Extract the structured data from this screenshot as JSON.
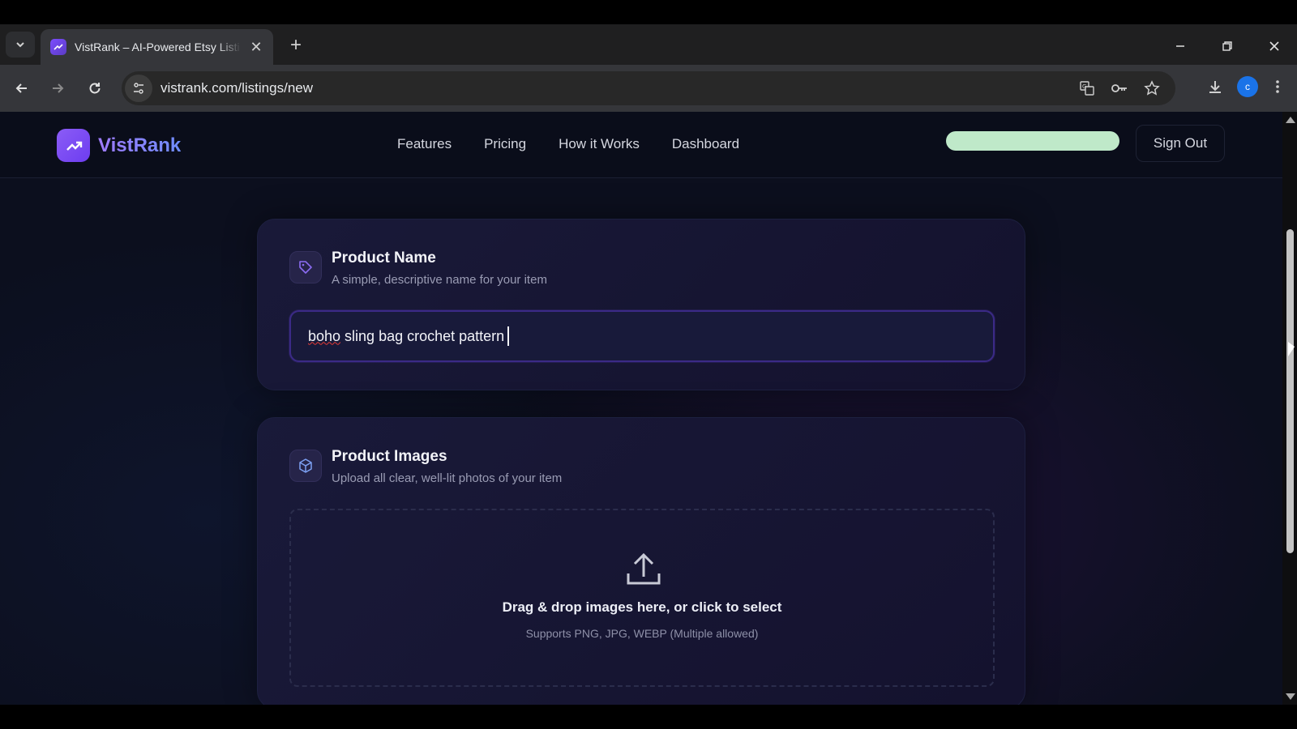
{
  "browser": {
    "tab_title": "VistRank – AI-Powered Etsy Listi",
    "url": "vistrank.com/listings/new",
    "profile_initial": "c"
  },
  "nav": {
    "brand": "VistRank",
    "links": [
      "Features",
      "Pricing",
      "How it Works",
      "Dashboard"
    ],
    "sign_out": "Sign Out"
  },
  "product_name": {
    "title": "Product Name",
    "subtitle": "A simple, descriptive name for your item",
    "value_misspelled": "boho",
    "value_rest": " sling bag crochet pattern"
  },
  "product_images": {
    "title": "Product Images",
    "subtitle": "Upload all clear, well-lit photos of your item",
    "drop_title": "Drag & drop images here, or click to select",
    "drop_sub": "Supports PNG, JPG, WEBP (Multiple allowed)"
  },
  "colors": {
    "accent": "#7c4dff",
    "page_bg": "#0c0f1e",
    "pill": "#bfe9c9"
  },
  "icons": [
    "chevron-down-icon",
    "close-icon",
    "plus-icon",
    "minimize-icon",
    "restore-icon",
    "back-icon",
    "forward-icon",
    "reload-icon",
    "site-info-icon",
    "translate-icon",
    "password-key-icon",
    "star-icon",
    "download-icon",
    "more-vert-icon",
    "tag-icon",
    "cube-icon",
    "upload-icon"
  ]
}
